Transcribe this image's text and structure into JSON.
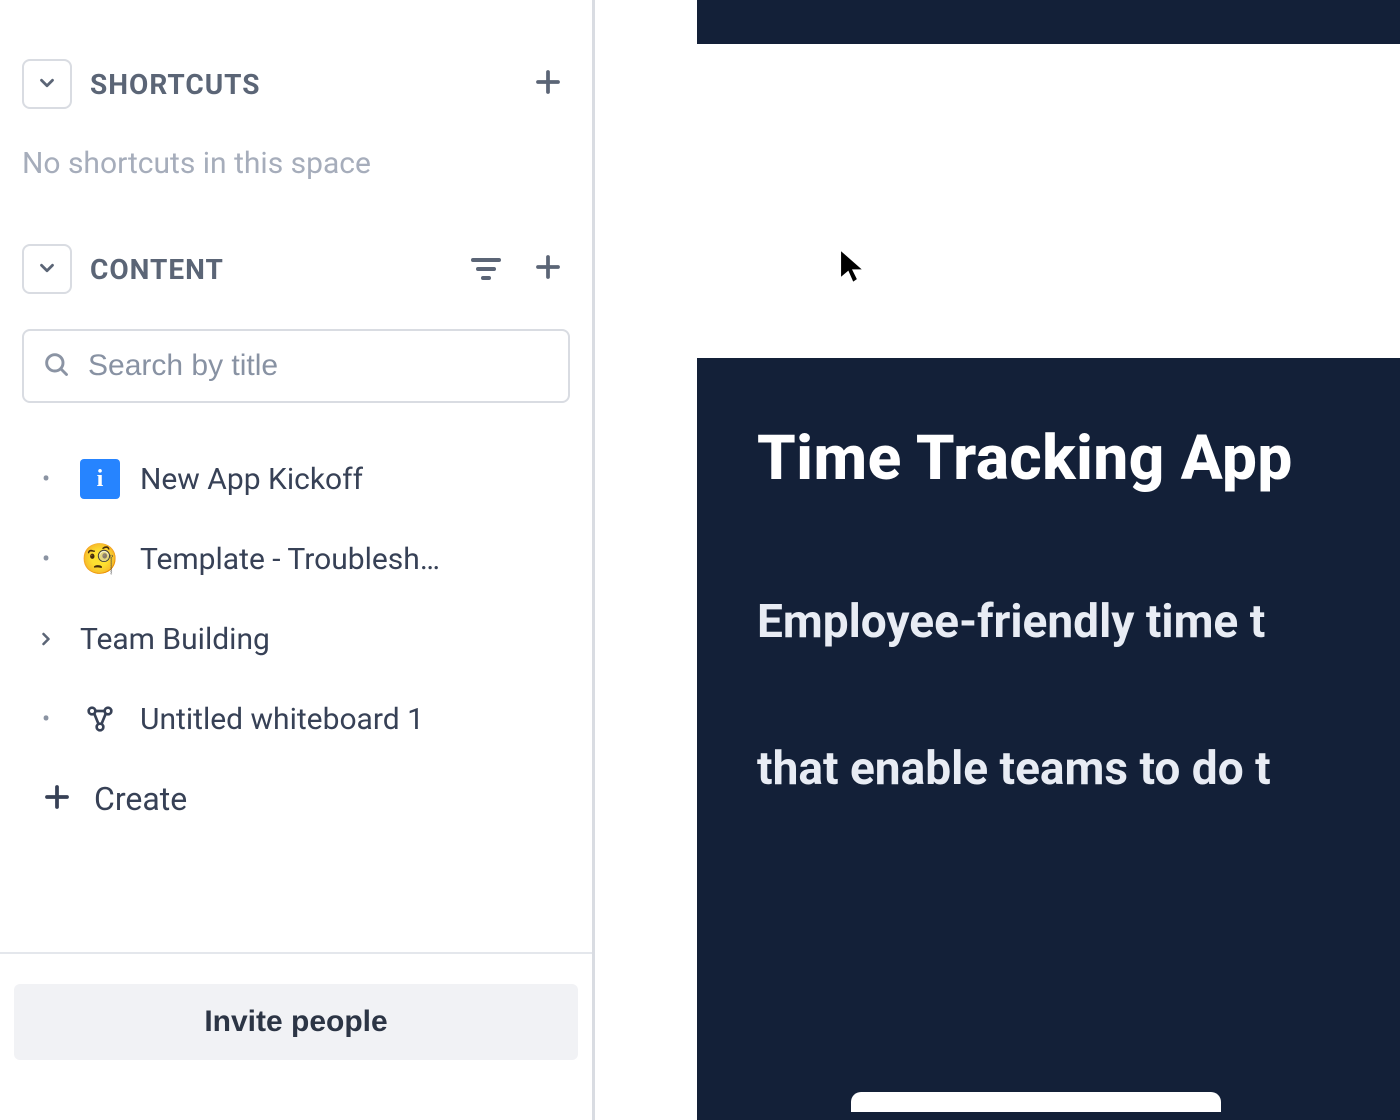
{
  "sidebar": {
    "shortcuts": {
      "title": "SHORTCUTS",
      "empty_text": "No shortcuts in this space"
    },
    "content": {
      "title": "CONTENT",
      "search_placeholder": "Search by title",
      "items": [
        {
          "label": "New App Kickoff",
          "icon": "info"
        },
        {
          "label": "Template - Troublesh…",
          "icon": "face-monocle"
        },
        {
          "label": "Team Building",
          "icon": "chevron"
        },
        {
          "label": "Untitled whiteboard 1",
          "icon": "whiteboard"
        }
      ],
      "create_label": "Create"
    },
    "invite_label": "Invite people"
  },
  "main": {
    "hero_title": "Time Tracking App",
    "hero_line1": "Employee-friendly time t",
    "hero_line2": "that enable teams to do t"
  }
}
